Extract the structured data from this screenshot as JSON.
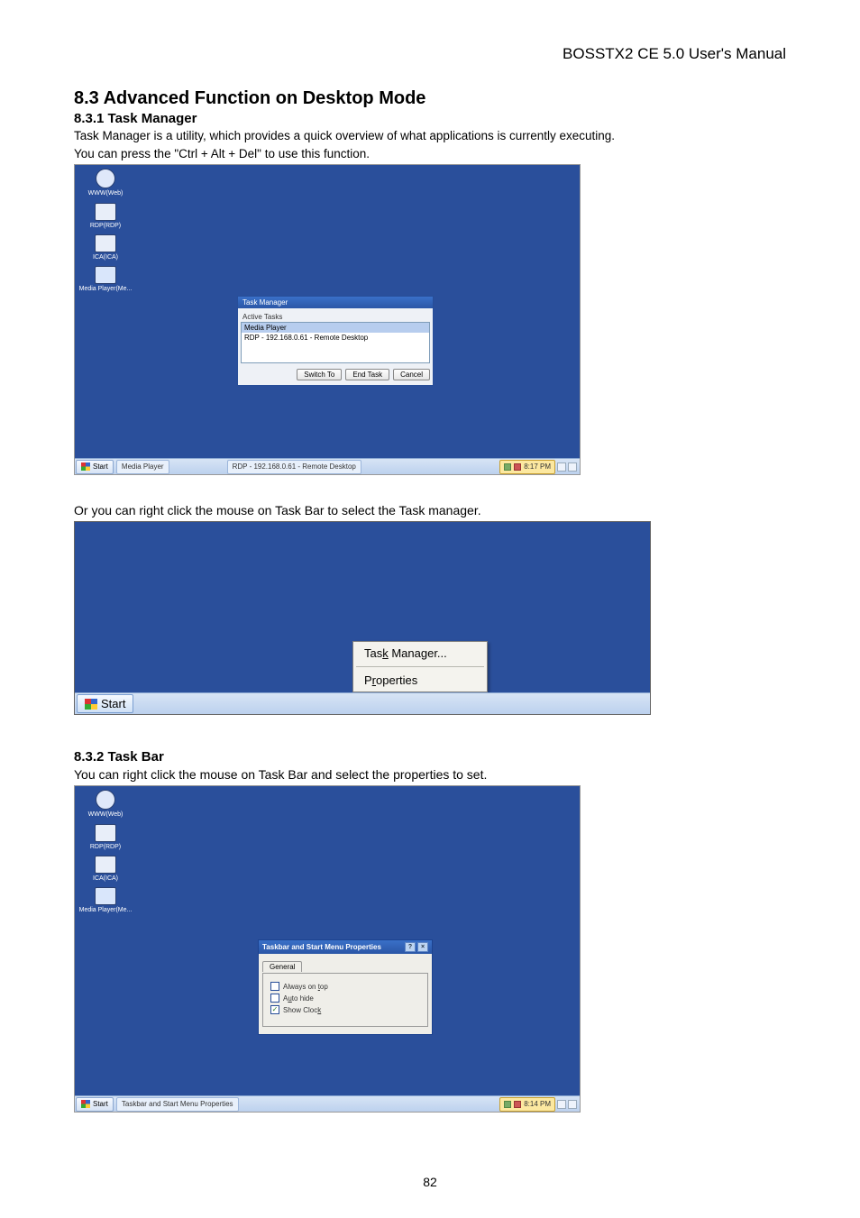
{
  "header": {
    "doc_title": "BOSSTX2 CE 5.0 User's Manual"
  },
  "sec": {
    "h2": "8.3 Advanced Function on Desktop Mode",
    "h3_1": "8.3.1 Task Manager",
    "p1": "Task Manager is a utility, which provides a quick overview of what applications is currently executing.",
    "p2": "You can press the \"Ctrl + Alt + Del\" to use this function.",
    "p_mid": "Or you can right click the mouse on Task Bar to select the Task manager.",
    "h3_2": "8.3.2 Task Bar",
    "p3": "You can right click the mouse on Task Bar and select the properties to set."
  },
  "shot1": {
    "icons": [
      "WWW(Web)",
      "RDP(RDP)",
      "ICA(ICA)",
      "Media Player(Me..."
    ],
    "tm_title": "Task Manager",
    "tm_label": "Active Tasks",
    "tm_items": [
      "Media Player",
      "RDP - 192.168.0.61 - Remote Desktop"
    ],
    "btn_switch": "Switch To",
    "btn_end": "End Task",
    "btn_cancel": "Cancel",
    "taskbar": {
      "start": "Start",
      "task_a": "Media Player",
      "task_b": "RDP - 192.168.0.61 - Remote Desktop",
      "time": "8:17 PM"
    }
  },
  "shot2": {
    "ctx_task_prefix": "Tas",
    "ctx_task_underl": "k",
    "ctx_task_suffix": " Manager...",
    "ctx_prop_prefix": "P",
    "ctx_prop_underl": "r",
    "ctx_prop_suffix": "operties",
    "start": "Start"
  },
  "shot3": {
    "icons": [
      "WWW(Web)",
      "RDP(RDP)",
      "ICA(ICA)",
      "Media Player(Me..."
    ],
    "title": "Taskbar and Start Menu Properties",
    "tab": "General",
    "opt_top": "Always on top",
    "opt_top_u": "t",
    "opt_auto_prefix": "A",
    "opt_auto_u": "u",
    "opt_auto_suffix": "to hide",
    "opt_clock": "Show Cloc",
    "opt_clock_u": "k",
    "chk_on": "✓",
    "taskbar": {
      "start": "Start",
      "task_a": "Taskbar and Start Menu Properties",
      "time": "8:14 PM"
    }
  },
  "page_number": "82"
}
